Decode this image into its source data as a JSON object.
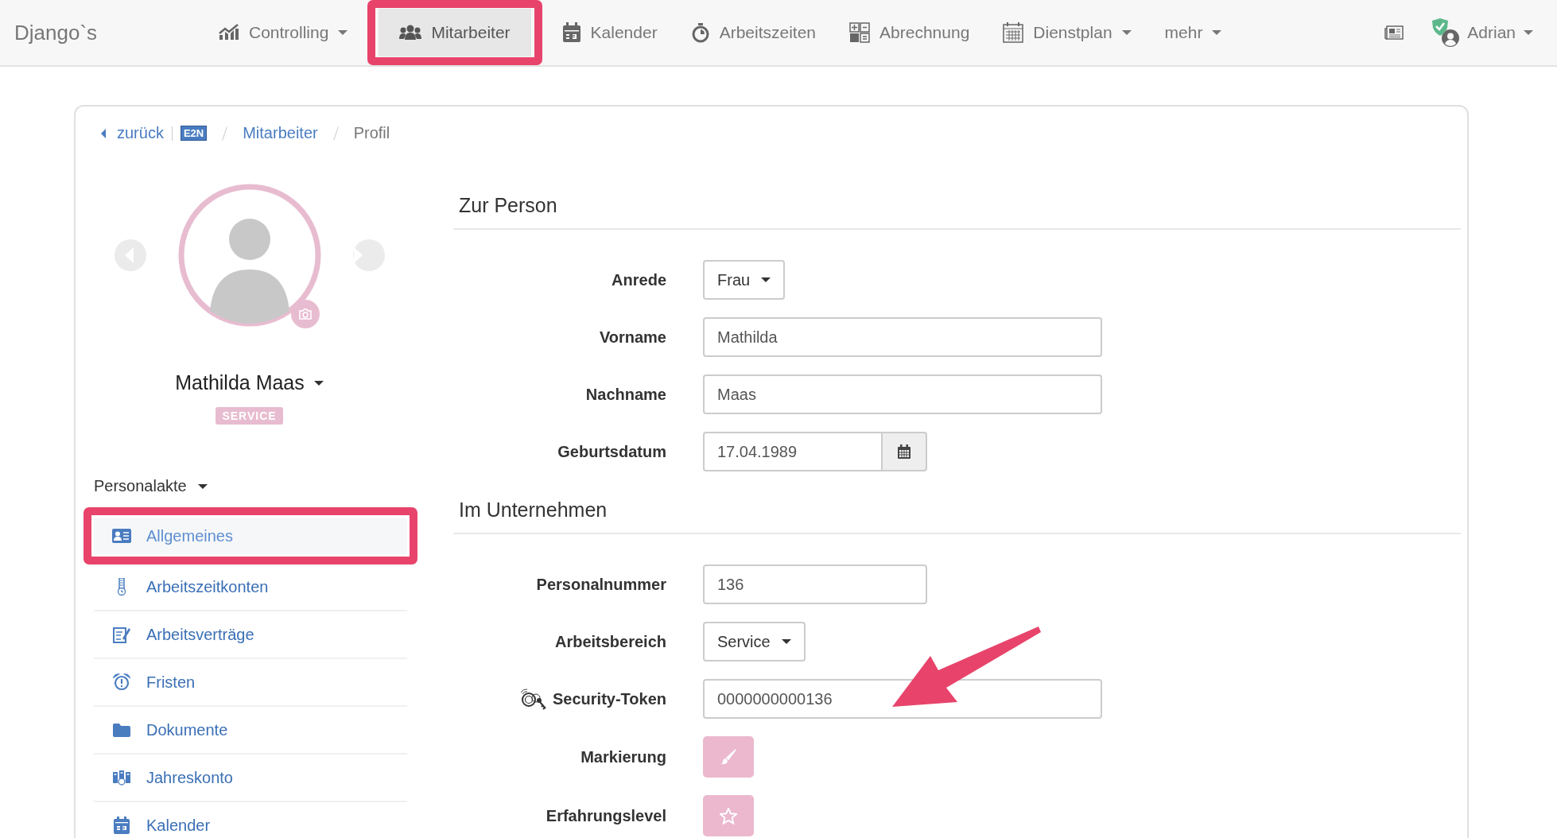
{
  "brand": "Django`s",
  "nav": [
    {
      "label": "Controlling",
      "dropdown": true,
      "selected": false,
      "annotated": false
    },
    {
      "label": "Mitarbeiter",
      "dropdown": false,
      "selected": true,
      "annotated": true
    },
    {
      "label": "Kalender",
      "dropdown": false,
      "selected": false,
      "annotated": false
    },
    {
      "label": "Arbeitszeiten",
      "dropdown": false,
      "selected": false,
      "annotated": false
    },
    {
      "label": "Abrechnung",
      "dropdown": false,
      "selected": false,
      "annotated": false
    },
    {
      "label": "Dienstplan",
      "dropdown": true,
      "selected": false,
      "annotated": false
    },
    {
      "label": "mehr",
      "dropdown": true,
      "selected": false,
      "annotated": false
    }
  ],
  "user": {
    "name": "Adrian",
    "verified": true
  },
  "breadcrumb": {
    "back": "zurück",
    "logo": "E2N",
    "items": [
      {
        "label": "Mitarbeiter",
        "link": true
      },
      {
        "label": "Profil",
        "link": false
      }
    ]
  },
  "profile": {
    "name": "Mathilda Maas",
    "badge": "SERVICE"
  },
  "sidebar": {
    "title": "Personalakte",
    "items": [
      {
        "label": "Allgemeines",
        "selected": true,
        "annotated": true
      },
      {
        "label": "Arbeitszeitkonten",
        "selected": false,
        "annotated": false
      },
      {
        "label": "Arbeitsverträge",
        "selected": false,
        "annotated": false
      },
      {
        "label": "Fristen",
        "selected": false,
        "annotated": false
      },
      {
        "label": "Dokumente",
        "selected": false,
        "annotated": false
      },
      {
        "label": "Jahreskonto",
        "selected": false,
        "annotated": false
      },
      {
        "label": "Kalender",
        "selected": false,
        "annotated": false
      }
    ]
  },
  "sections": [
    {
      "title": "Zur Person",
      "fields": [
        {
          "kind": "select",
          "label": "Anrede",
          "value": "Frau"
        },
        {
          "kind": "text",
          "label": "Vorname",
          "value": "Mathilda"
        },
        {
          "kind": "text",
          "label": "Nachname",
          "value": "Maas"
        },
        {
          "kind": "date",
          "label": "Geburtsdatum",
          "value": "17.04.1989"
        }
      ]
    },
    {
      "title": "Im Unternehmen",
      "fields": [
        {
          "kind": "number",
          "label": "Personalnummer",
          "value": "136"
        },
        {
          "kind": "select",
          "label": "Arbeitsbereich",
          "value": "Service"
        },
        {
          "kind": "token",
          "label": "Security-Token",
          "value": "0000000000136"
        },
        {
          "kind": "color",
          "label": "Markierung"
        },
        {
          "kind": "level",
          "label": "Erfahrungslevel"
        }
      ]
    }
  ]
}
